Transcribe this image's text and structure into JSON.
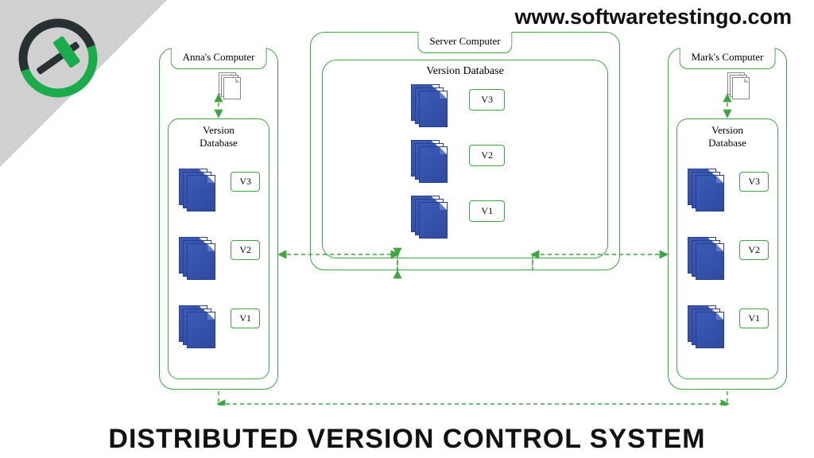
{
  "site_url": "www.softwaretestingo.com",
  "bottom_title": "DISTRIBUTED VERSION CONTROL SYSTEM",
  "server": {
    "title": "Server Computer",
    "db_label": "Version Database",
    "versions": [
      "V3",
      "V2",
      "V1"
    ]
  },
  "clients": {
    "left": {
      "title": "Anna's Computer",
      "db_label": "Version\nDatabase",
      "versions": [
        "V3",
        "V2",
        "V1"
      ]
    },
    "right": {
      "title": "Mark's Computer",
      "db_label": "Version\nDatabase",
      "versions": [
        "V3",
        "V2",
        "V1"
      ]
    }
  },
  "colors": {
    "outline": "#3fa63f",
    "sheet_fill": "#3b5bb5",
    "triangle": "#d0d0d0"
  }
}
